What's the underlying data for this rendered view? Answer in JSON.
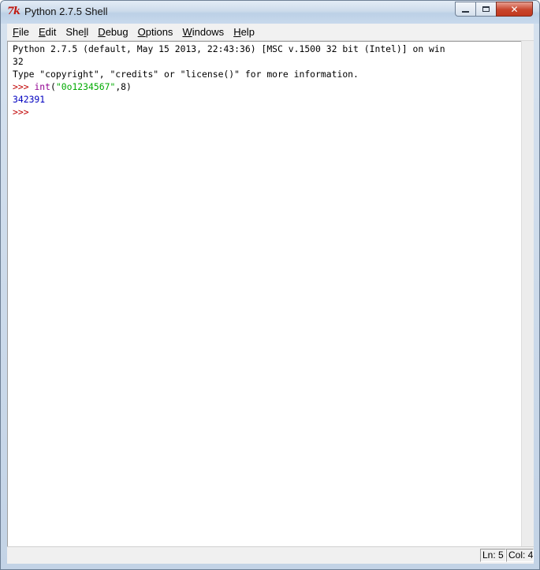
{
  "window": {
    "title": "Python 2.7.5 Shell",
    "icon": "tk-feather-icon"
  },
  "menu": {
    "items": [
      {
        "label": "File",
        "mnemonic": "F",
        "rest": "ile"
      },
      {
        "label": "Edit",
        "mnemonic": "E",
        "rest": "dit"
      },
      {
        "label": "Shell",
        "mnemonic": "",
        "prefix": "She",
        "mnemonic2": "l",
        "rest": "l"
      },
      {
        "label": "Debug",
        "mnemonic": "D",
        "rest": "ebug"
      },
      {
        "label": "Options",
        "mnemonic": "O",
        "rest": "ptions"
      },
      {
        "label": "Windows",
        "mnemonic": "W",
        "rest": "indows"
      },
      {
        "label": "Help",
        "mnemonic": "H",
        "rest": "elp"
      }
    ]
  },
  "shell": {
    "banner_line1": "Python 2.7.5 (default, May 15 2013, 22:43:36) [MSC v.1500 32 bit (Intel)] on win",
    "banner_line2": "32",
    "banner_line3": "Type \"copyright\", \"credits\" or \"license()\" for more information.",
    "prompt": ">>> ",
    "cmd_builtin": "int",
    "cmd_open": "(",
    "cmd_string": "\"0o1234567\"",
    "cmd_rest": ",8)",
    "output": "342391",
    "prompt2": ">>> "
  },
  "status": {
    "ln": "Ln: 5",
    "col": "Col: 4"
  },
  "colors": {
    "prompt": "#c00000",
    "builtin": "#900090",
    "string": "#00aa00",
    "output": "#0000c0"
  }
}
